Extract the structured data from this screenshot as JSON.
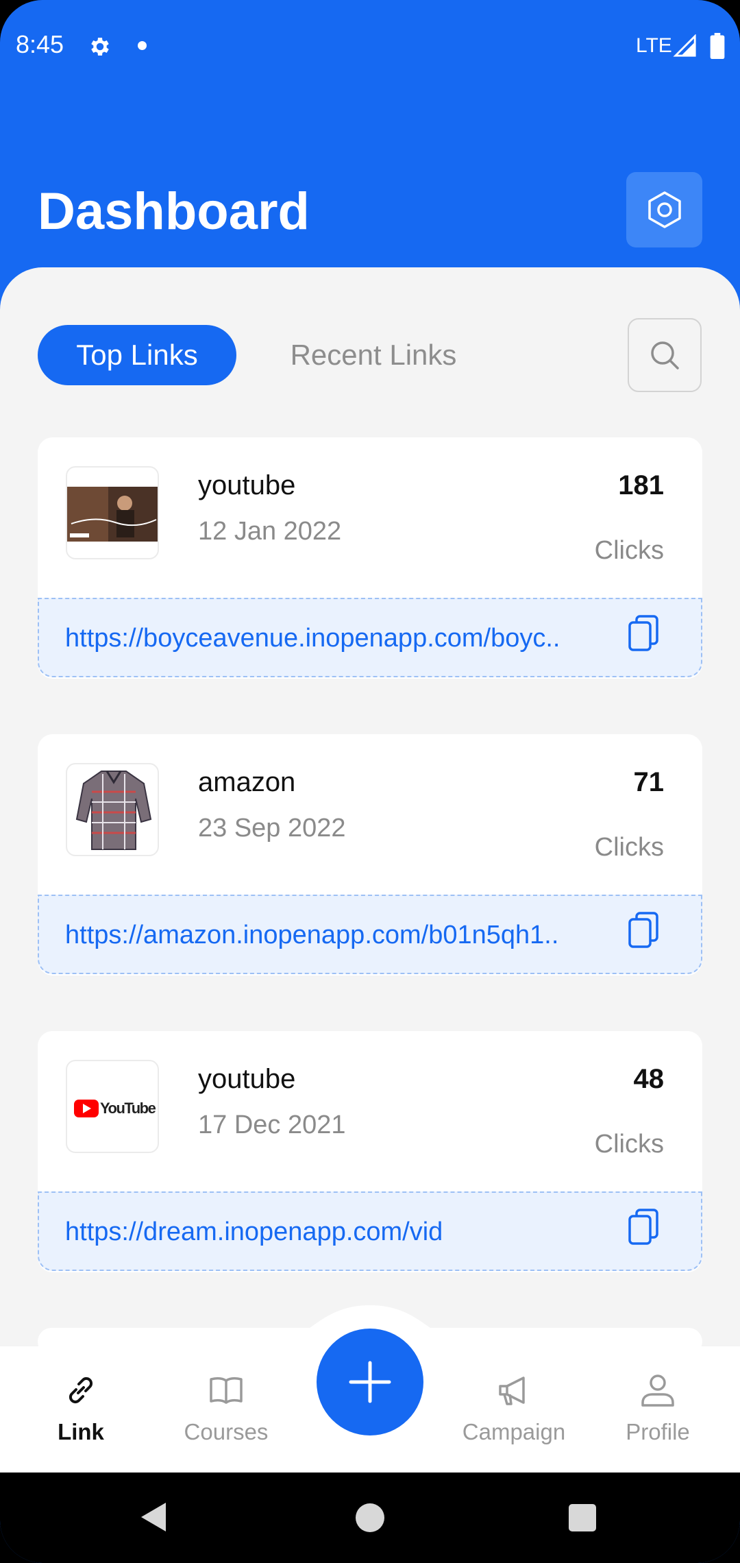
{
  "status_bar": {
    "time": "8:45",
    "network": "LTE"
  },
  "header": {
    "title": "Dashboard"
  },
  "tabs": {
    "top_links": "Top Links",
    "recent_links": "Recent Links"
  },
  "links": [
    {
      "title": "youtube",
      "date": "12 Jan 2022",
      "count": "181",
      "clicks_label": "Clicks",
      "url": "https://boyceavenue.inopenapp.com/boyc..",
      "thumbnail": "video-thumbnail"
    },
    {
      "title": "amazon",
      "date": "23 Sep 2022",
      "count": "71",
      "clicks_label": "Clicks",
      "url": "https://amazon.inopenapp.com/b01n5qh1..",
      "thumbnail": "shirt-thumbnail"
    },
    {
      "title": "youtube",
      "date": "17 Dec 2021",
      "count": "48",
      "clicks_label": "Clicks",
      "url": "https://dream.inopenapp.com/vid",
      "thumbnail": "youtube-logo-thumbnail",
      "thumbnail_text": "YouTube"
    }
  ],
  "bottom_nav": {
    "link": "Link",
    "courses": "Courses",
    "campaign": "Campaign",
    "profile": "Profile"
  },
  "colors": {
    "primary": "#1669F2",
    "background": "#F4F4F4",
    "link_bg": "#EAF2FE"
  }
}
